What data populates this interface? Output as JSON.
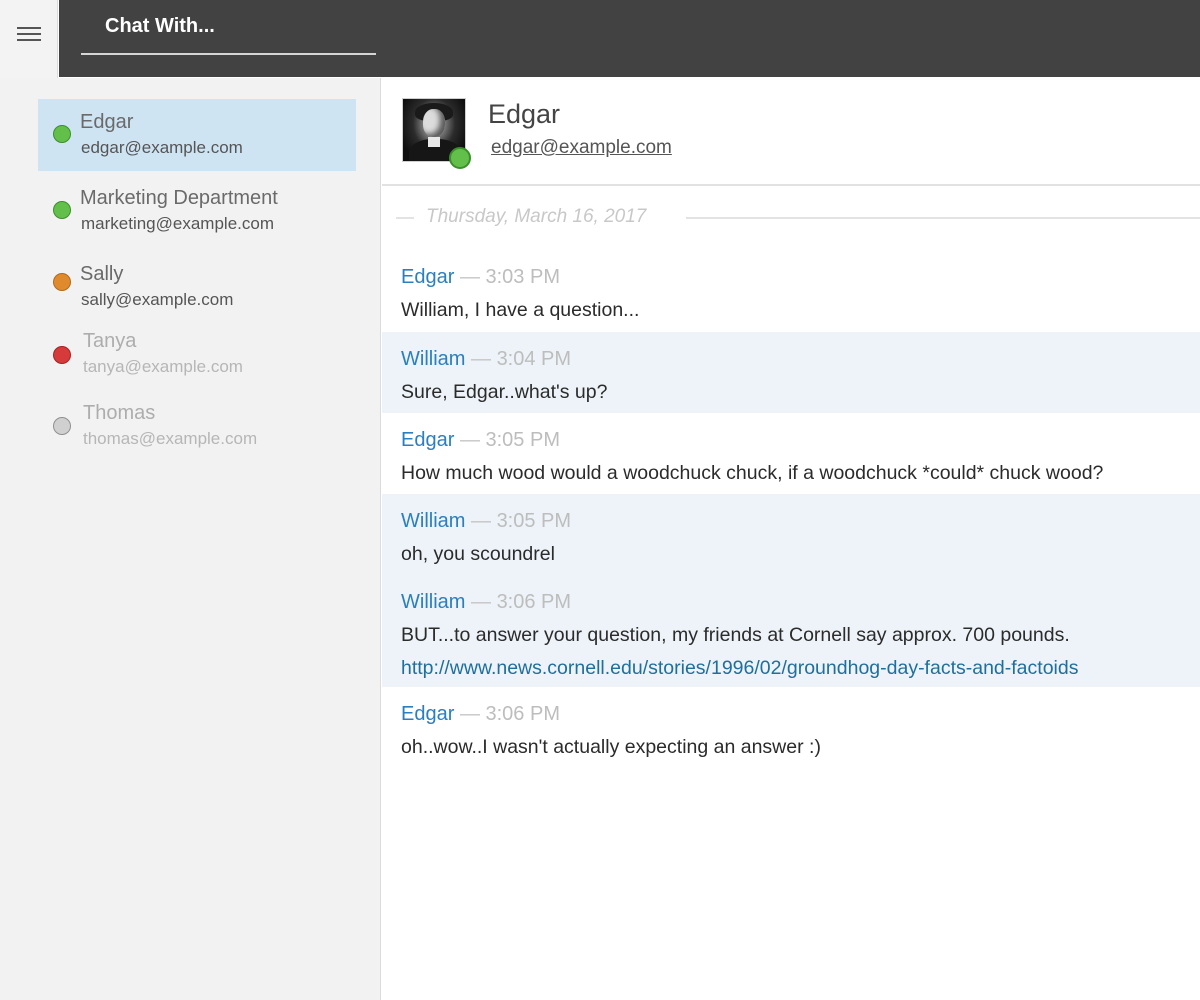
{
  "topbar": {
    "menu_icon": "hamburger-menu-icon",
    "chat_with_placeholder": "Chat With..."
  },
  "contacts": [
    {
      "name": "Edgar",
      "email": "edgar@example.com",
      "status": "online",
      "status_color": "#62c04a",
      "selected": true
    },
    {
      "name": "Marketing Department",
      "email": "marketing@example.com",
      "status": "online",
      "status_color": "#62c04a",
      "selected": false
    },
    {
      "name": "Sally",
      "email": "sally@example.com",
      "status": "away",
      "status_color": "#e08a2e",
      "selected": false
    },
    {
      "name": "Tanya",
      "email": "tanya@example.com",
      "status": "busy",
      "status_color": "#d63a3a",
      "selected": false
    },
    {
      "name": "Thomas",
      "email": "thomas@example.com",
      "status": "offline",
      "status_color": "#d0d0d0",
      "selected": false
    }
  ],
  "conversation": {
    "name": "Edgar",
    "email": "edgar@example.com",
    "status_color": "#62c04a",
    "date": "Thursday, March 16, 2017",
    "separator": "—",
    "messages": [
      {
        "author": "Edgar",
        "time": "3:03 PM",
        "text": "William, I have a question..."
      },
      {
        "author": "William",
        "time": "3:04 PM",
        "text": "Sure, Edgar..what's up?"
      },
      {
        "author": "Edgar",
        "time": "3:05 PM",
        "text": "How much wood would a woodchuck chuck, if a woodchuck *could* chuck wood?"
      },
      {
        "author": "William",
        "time": "3:05 PM",
        "text": "oh, you scoundrel"
      },
      {
        "author": "William",
        "time": "3:06 PM",
        "text": "BUT...to answer your question, my friends at Cornell say approx. 700 pounds.",
        "link": "http://www.news.cornell.edu/stories/1996/02/groundhog-day-facts-and-factoids"
      },
      {
        "author": "Edgar",
        "time": "3:06 PM",
        "text": "oh..wow..I wasn't actually expecting an answer :)"
      }
    ]
  },
  "colors": {
    "topbar": "#424242",
    "selected_contact": "#cfe4f3",
    "own_message_shade": "#edf3f8",
    "author": "#2a7fc0"
  }
}
